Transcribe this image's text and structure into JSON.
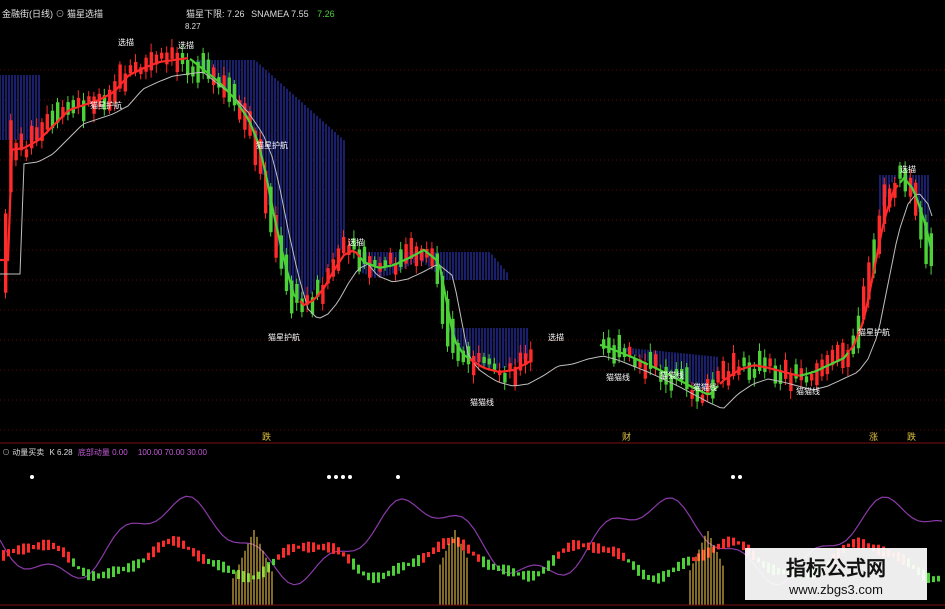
{
  "main_panel": {
    "title": "金融街(日线)",
    "indicator_name": "猫星选描",
    "readouts": [
      {
        "label": "猫星下限:",
        "value": "7.26"
      },
      {
        "label": "SNAMEA",
        "value": "7.55"
      },
      {
        "label": "",
        "value": "7.26"
      }
    ],
    "peak_price": "8.27",
    "markers": [
      "选描",
      "猫星护航",
      "猫星护航",
      "猫星护航",
      "选描",
      "选描",
      "选描",
      "选描",
      "猫星护航",
      "猫猫线",
      "猫猫线",
      "猫猫线",
      "猫猫线",
      "猫猫线"
    ],
    "event_labels": [
      "跌",
      "财",
      "涨",
      "跌"
    ]
  },
  "sub_panel": {
    "title": "动量买卖",
    "k_label": "K",
    "k_value": "6.28",
    "name2": "底部动量",
    "values": [
      "0.00",
      "100.00",
      "70.00",
      "30.00"
    ]
  },
  "watermark": {
    "line1": "指标公式网",
    "line2": "www.zbgs3.com"
  },
  "colors": {
    "up": "#ff2a2a",
    "down": "#4cd137",
    "sky": "#1a1f6b",
    "avg": "#bfbfbf",
    "purple": "#8b3aa8",
    "yellow": "#ffd54a"
  },
  "chart_data": {
    "type": "candlestick",
    "title": "",
    "y_ticks": [],
    "x_ticks": [],
    "closes": [
      7.9,
      7.95,
      8.0,
      7.98,
      8.05,
      8.1,
      8.08,
      8.15,
      8.2,
      8.22,
      8.18,
      8.25,
      8.27,
      8.2,
      8.1,
      7.9,
      7.6,
      7.3,
      7.05,
      6.95,
      6.9,
      6.85,
      6.8,
      6.75,
      6.7,
      6.72,
      6.75,
      6.8,
      6.85,
      6.9,
      6.95,
      7.0,
      7.05,
      7.1,
      7.0,
      6.95,
      6.9,
      6.95,
      7.0,
      7.05,
      7.1,
      7.05,
      7.0,
      6.95,
      6.9,
      6.95,
      6.98,
      7.0,
      7.05,
      7.1,
      7.15,
      7.2,
      7.25,
      7.3,
      7.45,
      7.6,
      7.55,
      7.4,
      7.3
    ]
  }
}
